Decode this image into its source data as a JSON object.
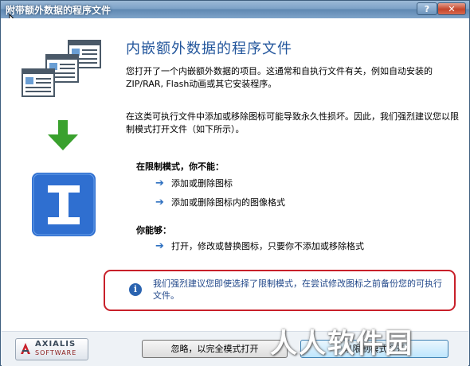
{
  "window": {
    "title": "附带额外数据的程序文件"
  },
  "titlebar": {
    "help_label": "?",
    "close_label": "✕"
  },
  "main": {
    "heading": "内嵌额外数据的程序文件",
    "paragraph1": "您打开了一个内嵌额外数据的项目。这通常和自执行文件有关，例如自动安装的ZIP/RAR, Flash动画或其它安装程序。",
    "paragraph2": "在这类可执行文件中添加或移除图标可能导致永久性损坏。因此，我们强烈建议您以限制模式打开文件（如下所示）。",
    "restricted_heading": "在限制模式，你不能：",
    "cannot_items": [
      "添加或删除图标",
      "添加或删除图标内的图像格式"
    ],
    "can_heading": "你能够：",
    "can_items": [
      "打开，修改或替换图标，只要你不添加或移除格式"
    ]
  },
  "notice": {
    "icon": "info-icon",
    "text": "我们强烈建议您即使选择了限制模式，在尝试修改图标之前备份您的可执行文件。"
  },
  "footer": {
    "logo_line1": "AXIALIS",
    "logo_line2": "SOFTWARE",
    "full_mode_button": "忽略，以完全模式打开",
    "restricted_mode_button": "以限制模式打开"
  },
  "watermark": "人人软件园",
  "colors": {
    "heading": "#23569c",
    "notice_border": "#c8202a",
    "arrow": "#2c6fc0",
    "download_arrow": "#3aa12e",
    "app_icon": "#2f6fd0"
  }
}
